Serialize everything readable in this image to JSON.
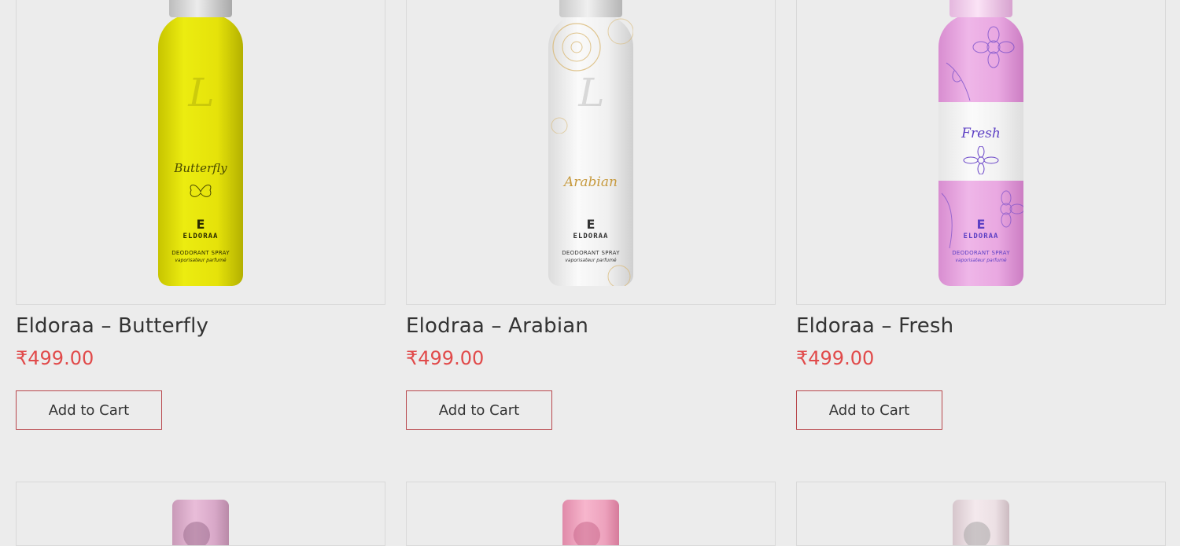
{
  "products": [
    {
      "title": "Eldoraa – Butterfly",
      "price": "₹499.00",
      "button": "Add to Cart",
      "image": {
        "scent": "Butterfly",
        "logo_letter": "E",
        "brand": "ELDORAA",
        "spray": "DEODORANT SPRAY",
        "sub": "vaporisateur parfumé",
        "color": "#e5e20a"
      }
    },
    {
      "title": "Elodraa – Arabian",
      "price": "₹499.00",
      "button": "Add to Cart",
      "image": {
        "scent": "Arabian",
        "logo_letter": "E",
        "brand": "ELDORAA",
        "spray": "DEODORANT SPRAY",
        "sub": "vaporisateur parfumé",
        "color": "#f0f0f0"
      }
    },
    {
      "title": "Eldoraa – Fresh",
      "price": "₹499.00",
      "button": "Add to Cart",
      "image": {
        "scent": "Fresh",
        "logo_letter": "E",
        "brand": "ELDORAA",
        "spray": "DEODORANT SPRAY",
        "sub": "vaporisateur parfumé",
        "color": "#e9a8e1"
      }
    }
  ],
  "colors": {
    "background": "#ececec",
    "price": "#e14a4a",
    "button_border": "#b8474c",
    "text": "#333333"
  }
}
